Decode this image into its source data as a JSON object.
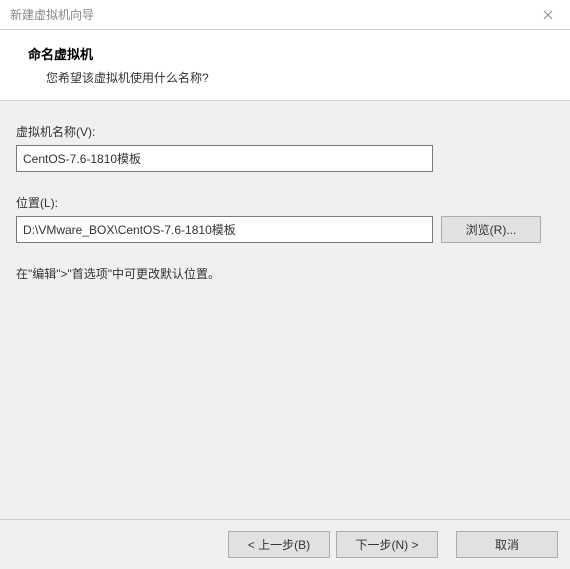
{
  "window": {
    "title": "新建虚拟机向导"
  },
  "header": {
    "title": "命名虚拟机",
    "subtitle": "您希望该虚拟机使用什么名称?"
  },
  "form": {
    "name_label": "虚拟机名称(V):",
    "name_value": "CentOS-7.6-1810模板",
    "location_label": "位置(L):",
    "location_value": "D:\\VMware_BOX\\CentOS-7.6-1810模板",
    "browse_label": "浏览(R)...",
    "hint": "在\"编辑\">\"首选项\"中可更改默认位置。"
  },
  "footer": {
    "back_label": "< 上一步(B)",
    "next_label": "下一步(N) >",
    "cancel_label": "取消"
  }
}
